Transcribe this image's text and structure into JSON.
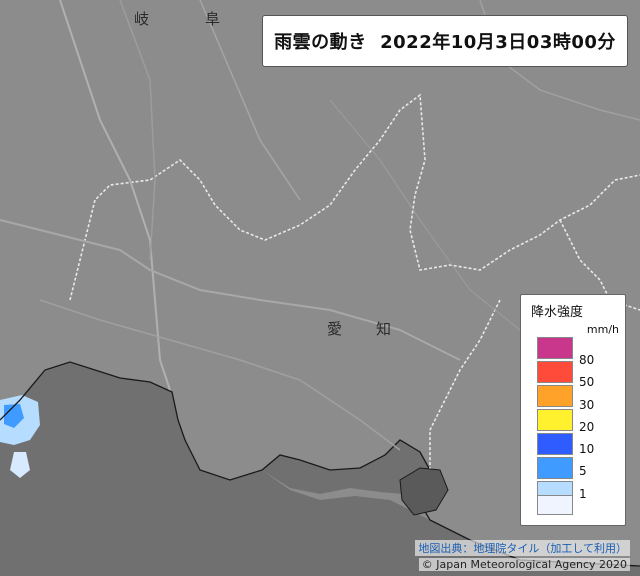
{
  "title": {
    "label": "雨雲の動き",
    "datetime": "2022年10月3日03時00分"
  },
  "map": {
    "region_labels": [
      {
        "text": "岐",
        "name": "map-label-gifu-1"
      },
      {
        "text": "阜",
        "name": "map-label-gifu-2"
      },
      {
        "text": "愛",
        "name": "map-label-aichi-1"
      },
      {
        "text": "知",
        "name": "map-label-aichi-2"
      }
    ]
  },
  "legend": {
    "title": "降水強度",
    "unit": "mm/h",
    "levels": [
      {
        "label": "80",
        "color": "#c8378c"
      },
      {
        "label": "50",
        "color": "#ff4b3a"
      },
      {
        "label": "30",
        "color": "#ffa22a"
      },
      {
        "label": "20",
        "color": "#fff12e"
      },
      {
        "label": "10",
        "color": "#2e5cff"
      },
      {
        "label": "5",
        "color": "#3f9bff"
      },
      {
        "label": "1",
        "color": "#b6dcff"
      },
      {
        "label": "",
        "color": "#f0f4ff"
      }
    ]
  },
  "attribution": {
    "source": "地図出典：地理院タイル（加工して利用）",
    "copyright": "© Japan Meteorological Agency 2020"
  }
}
